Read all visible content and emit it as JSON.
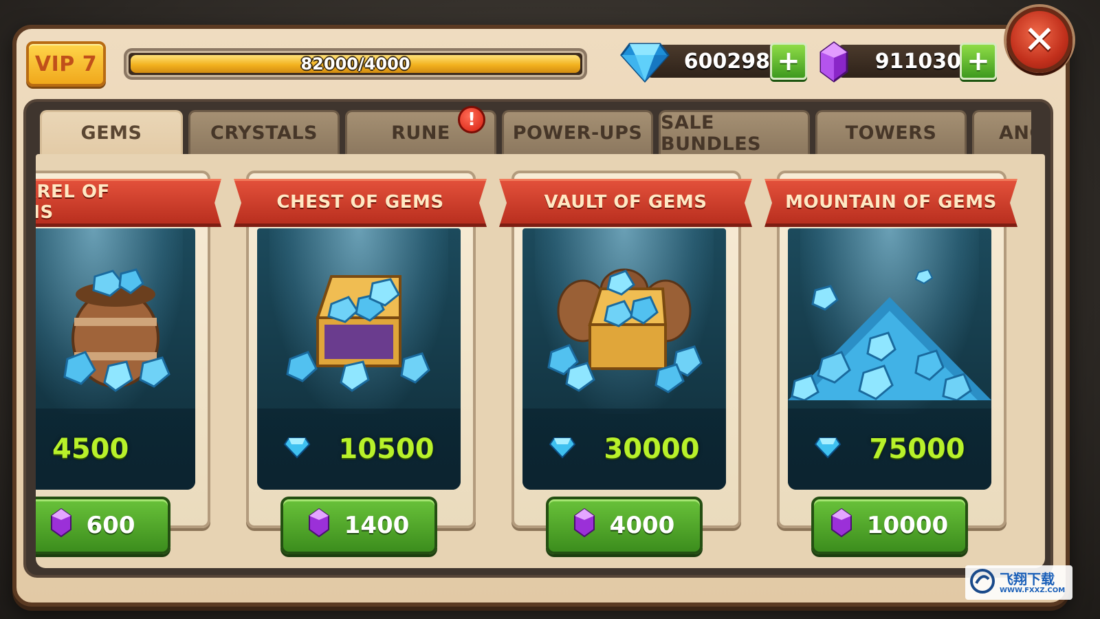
{
  "header": {
    "vip_label": "VIP 7",
    "vip_progress_text": "82000/4000",
    "vip_progress_fraction": 1.0
  },
  "currencies": {
    "gems": {
      "icon": "blue-gem-icon",
      "amount": "600298"
    },
    "crystals": {
      "icon": "purple-crystal-icon",
      "amount": "911030"
    }
  },
  "tabs": [
    {
      "label": "GEMS",
      "active": true
    },
    {
      "label": "CRYSTALS",
      "active": false
    },
    {
      "label": "RUNE",
      "active": false,
      "alert": "!"
    },
    {
      "label": "POWER-UPS",
      "active": false
    },
    {
      "label": "SALE BUNDLES",
      "active": false
    },
    {
      "label": "TOWERS",
      "active": false
    },
    {
      "label": "ANCI",
      "active": false
    }
  ],
  "packs": [
    {
      "title": "BARREL OF GEMS",
      "gems": "4500",
      "price": "600"
    },
    {
      "title": "CHEST OF GEMS",
      "gems": "10500",
      "price": "1400"
    },
    {
      "title": "VAULT OF GEMS",
      "gems": "30000",
      "price": "4000"
    },
    {
      "title": "MOUNTAIN OF GEMS",
      "gems": "75000",
      "price": "10000"
    }
  ],
  "watermark": {
    "line1": "飞翔下载",
    "line2": "WWW.FXXZ.COM"
  },
  "colors": {
    "frame": "#5b3a22",
    "banner_red": "#c8372a",
    "gem_blue": "#3fc1f0",
    "crystal_purple": "#a43ad8",
    "amount_green": "#b8f12a",
    "button_green": "#4fa72a"
  }
}
